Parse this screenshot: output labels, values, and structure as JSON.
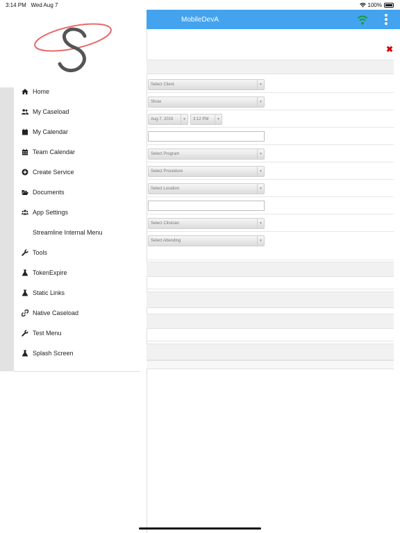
{
  "status_bar": {
    "time": "3:14 PM",
    "date": "Wed Aug 7",
    "battery": "100%"
  },
  "header": {
    "title": "MobileDevA"
  },
  "form": {
    "client": "Select Client",
    "status": "Show",
    "date": "Aug 7, 2019",
    "time": "3:12 PM",
    "program": "Select Program",
    "procedure": "Select Procedure",
    "location": "Select Location",
    "clinician": "Select Clinician",
    "attending": "Select Attending"
  },
  "menu": {
    "items": [
      {
        "label": "Home",
        "icon": "home-icon"
      },
      {
        "label": "My Caseload",
        "icon": "users-icon"
      },
      {
        "label": "My Calendar",
        "icon": "calendar-icon"
      },
      {
        "label": "Team Calendar",
        "icon": "calendar-grid-icon"
      },
      {
        "label": "Create Service",
        "icon": "plus-circle-icon"
      },
      {
        "label": "Documents",
        "icon": "folder-open-icon"
      },
      {
        "label": "App Settings",
        "icon": "users-group-icon"
      },
      {
        "label": "Streamline Internal Menu",
        "icon": ""
      },
      {
        "label": "Tools",
        "icon": "wrench-icon"
      },
      {
        "label": "TokenExpire",
        "icon": "flask-icon"
      },
      {
        "label": "Static Links",
        "icon": "flask-icon"
      },
      {
        "label": "Native Caseload",
        "icon": "link-icon"
      },
      {
        "label": "Test Menu",
        "icon": "wrench-icon"
      },
      {
        "label": "Splash Screen",
        "icon": "flask-icon"
      }
    ]
  },
  "colors": {
    "header": "#43a3ee",
    "wifi": "#1a9c2e",
    "close": "#d80000",
    "logo_ring": "#e86a6a",
    "logo_letter": "#555555"
  }
}
